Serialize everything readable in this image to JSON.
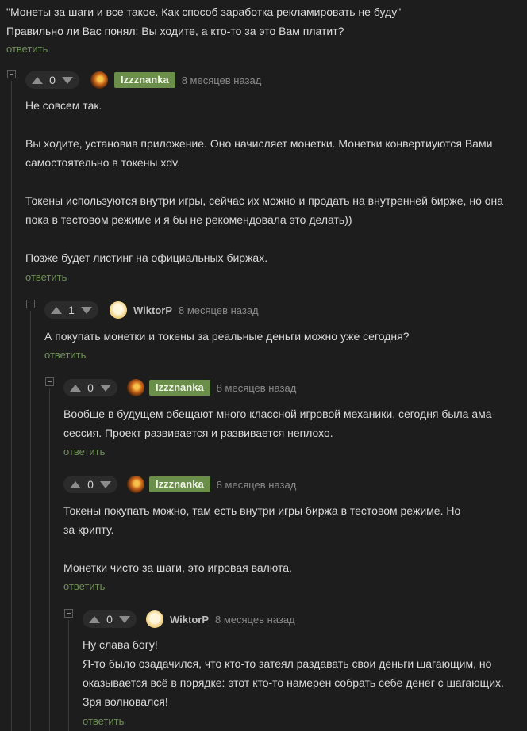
{
  "top": {
    "lines": [
      "\"Монеты за шаги и все такое. Как способ заработка рекламировать не буду\"",
      "Правильно ли Вас понял: Вы ходите, а кто-то за это Вам платит?"
    ],
    "reply": "ответить"
  },
  "comments": [
    {
      "score": "0",
      "author": "Izzznanka",
      "time": "8 месяцев назад",
      "paragraphs": [
        "Не совсем так.",
        "Вы ходите, установив приложение. Оно начисляет монетки. Монетки конвертиуются Вами\nсамостоятельно в токены xdv.",
        "Токены используются внутри игры, сейчас их можно и продать на внутренней бирже, но она\nпока в тестовом режиме и я бы не рекомендовала это делать))",
        "Позже будет листинг на официальных биржах."
      ],
      "reply": "ответить"
    },
    {
      "score": "1",
      "author": "WiktorP",
      "time": "8 месяцев назад",
      "paragraphs": [
        "А покупать монетки и токены за реальные деньги можно уже сегодня?"
      ],
      "reply": "ответить"
    },
    {
      "score": "0",
      "author": "Izzznanka",
      "time": "8 месяцев назад",
      "paragraphs": [
        "Вообще в будущем обещают много классной игровой механики, сегодня была ама-\nсессия. Проект развивается и развивается неплохо."
      ],
      "reply": "ответить"
    },
    {
      "score": "0",
      "author": "Izzznanka",
      "time": "8 месяцев назад",
      "paragraphs": [
        "Токены покупать можно, там есть внутри игры биржа в тестовом режиме. Но\nза крипту.",
        "Монетки чисто за шаги, это игровая валюта."
      ],
      "reply": "ответить"
    },
    {
      "score": "0",
      "author": "WiktorP",
      "time": "8 месяцев назад",
      "paragraphs": [
        "Ну слава богу!\nЯ-то было озадачился, что кто-то затеял раздавать свои деньги шагающим, но\nоказывается всё в порядке: этот кто-то намерен собрать себе денег с шагающих.\nЗря волновался!"
      ],
      "reply": "ответить"
    }
  ],
  "colors": {
    "background": "#1d1d1d",
    "reply_link": "#6f8f55",
    "author_badge": "#6b8f4a"
  },
  "icons": [
    "collapse-icon",
    "upvote-icon",
    "downvote-icon",
    "avatar"
  ]
}
